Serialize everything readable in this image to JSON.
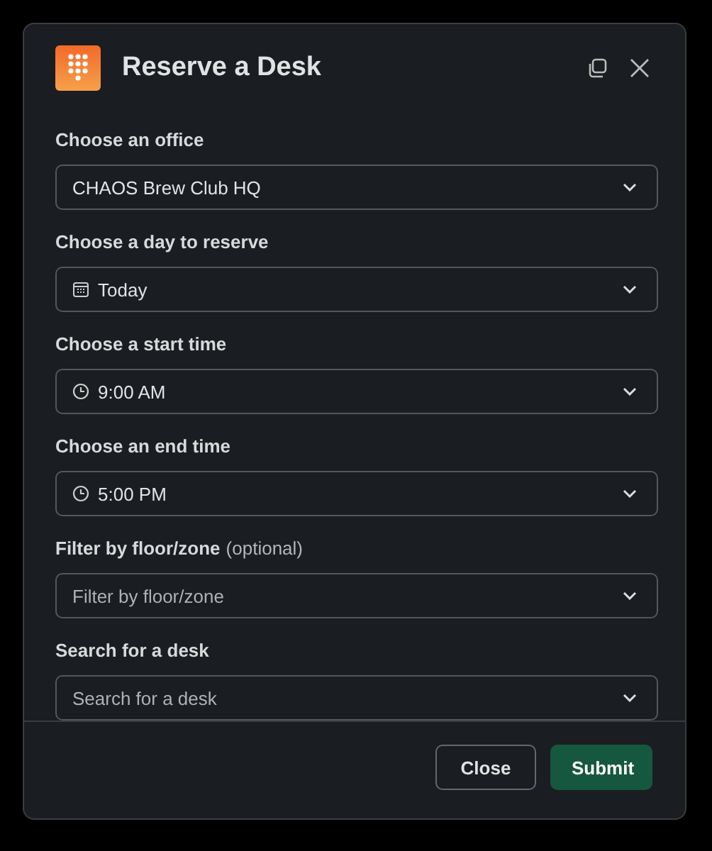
{
  "window": {
    "title": "Reserve a Desk"
  },
  "fields": [
    {
      "label": "Choose an office",
      "kind": "select",
      "value": "CHAOS Brew Club HQ"
    },
    {
      "label": "Choose a day to reserve",
      "kind": "date",
      "value": "Today"
    },
    {
      "label": "Choose a start time",
      "kind": "time",
      "value": "9:00 AM"
    },
    {
      "label": "Choose an end time",
      "kind": "time",
      "value": "5:00 PM"
    },
    {
      "label": "Filter by floor/zone",
      "hint": "(optional)",
      "kind": "select",
      "placeholder": "Filter by floor/zone"
    },
    {
      "label": "Search for a desk",
      "kind": "select",
      "placeholder": "Search for a desk"
    }
  ],
  "buttons": [
    {
      "label": "Close",
      "kind": "secondary"
    },
    {
      "label": "Submit",
      "kind": "primary"
    }
  ]
}
